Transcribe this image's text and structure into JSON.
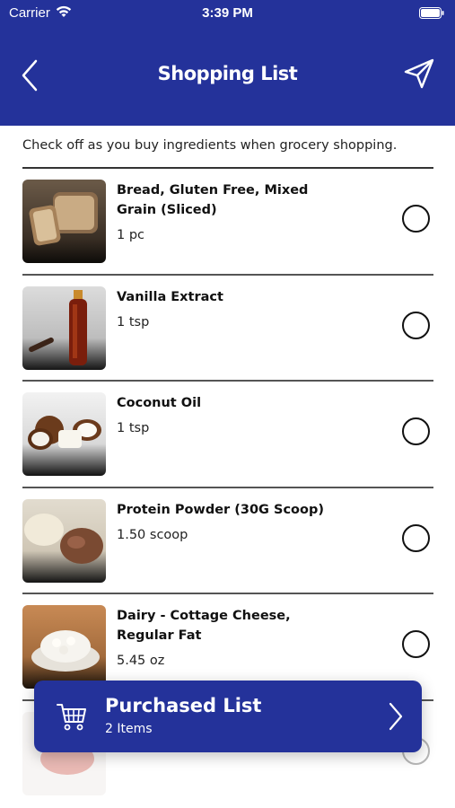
{
  "status_bar": {
    "carrier": "Carrier",
    "time": "3:39 PM"
  },
  "header": {
    "title": "Shopping List"
  },
  "instructions": "Check off as you buy ingredients when grocery shopping.",
  "items": [
    {
      "name": "Bread, Gluten Free, Mixed Grain (Sliced)",
      "qty": "1 pc"
    },
    {
      "name": "Vanilla Extract",
      "qty": "1 tsp"
    },
    {
      "name": "Coconut Oil",
      "qty": "1 tsp"
    },
    {
      "name": "Protein Powder (30G Scoop)",
      "qty": "1.50 scoop"
    },
    {
      "name": "Dairy - Cottage Cheese, Regular Fat",
      "qty": "5.45 oz"
    }
  ],
  "purchased": {
    "title": "Purchased List",
    "count": "2 Items"
  },
  "colors": {
    "brand": "#24329a",
    "text": "#111111",
    "divider": "#555555"
  }
}
